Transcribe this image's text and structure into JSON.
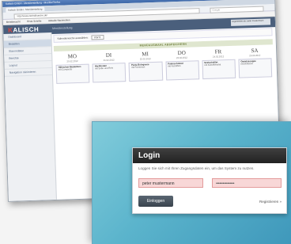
{
  "browser": {
    "window_title": "Kalisch GmbH - Menübestellung - Mozilla Firefox",
    "tab_label": "Kalisch GmbH - Menübestellung",
    "url": "http://www.zentralkueche.de/",
    "search_placeholder": "Google"
  },
  "bookmarks": [
    "Meistbesucht",
    "Erste Schritte",
    "Aktuelle Nachrichten"
  ],
  "app": {
    "logo_prefix": "K",
    "logo_rest": "ALISCH",
    "name": "Menübestellung",
    "user_label": "Angemeldet als: peter mustermann"
  },
  "sidebar": [
    "Dashboard",
    "Bestellen",
    "Stammdaten",
    "Berichte",
    "Logout",
    "Navigation minimieren"
  ],
  "filter": {
    "label": "Kalenderwoche auswählen:",
    "value": "KW 8"
  },
  "menu_heading": "MENÜAUSWAHL ABSPEICHERN",
  "days": [
    {
      "name": "MO",
      "date": "20.02.2012",
      "title": "Hähnchen-Medaillons",
      "text": "mit Currysoße"
    },
    {
      "name": "DI",
      "date": "21.02.2012",
      "title": "Hackbraten",
      "text": "mit Soße und Reis"
    },
    {
      "name": "MI",
      "date": "22.02.2012",
      "title": "Pasta Bolognese",
      "text": "mit Parmesan"
    },
    {
      "name": "DO",
      "date": "23.02.2012",
      "title": "Putenschnitzel",
      "text": "mit Kartoffeln"
    },
    {
      "name": "FR",
      "date": "24.02.2012",
      "title": "Seelachsfilet",
      "text": "mit Kartoffelsalat"
    },
    {
      "name": "SA",
      "date": "25.02.2012",
      "title": "Gemüsesuppe",
      "text": "mit Brötchen"
    }
  ],
  "login": {
    "title": "Login",
    "description": "Loggen Sie sich mit Ihren Zugangsdaten ein, um das System zu nutzen.",
    "username": "peter mustermann",
    "password_mask": "••••••••••••••••",
    "submit_label": "Einloggen",
    "register_label": "Registrieren »"
  }
}
